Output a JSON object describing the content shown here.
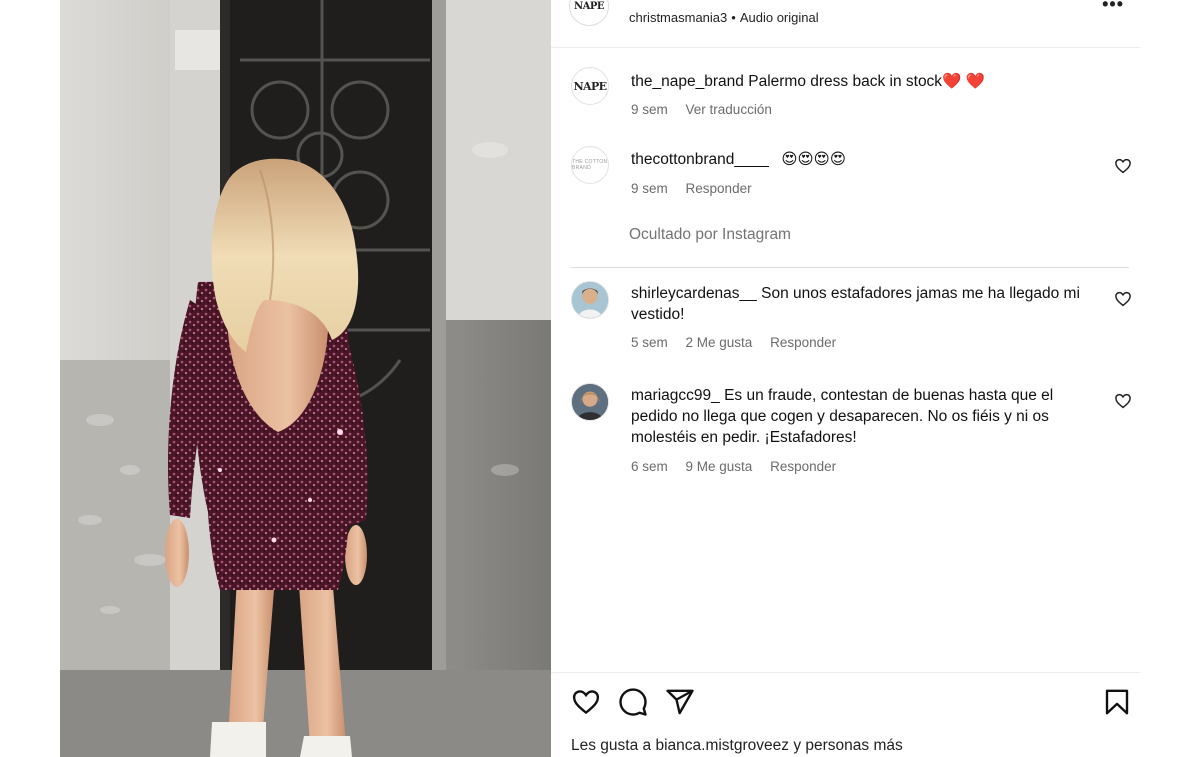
{
  "header": {
    "audio_user": "christmasmania3",
    "separator": "•",
    "audio_label": "Audio original",
    "brand_logo_text": "NAPE",
    "more_icon": "more-horizontal-icon"
  },
  "comments": [
    {
      "username": "the_nape_brand",
      "text": "Palermo dress back in stock",
      "emoji": "❤️ ❤️",
      "time": "9 sem",
      "action": "Ver traducción",
      "avatar_text": "NAPE"
    },
    {
      "username": "thecottonbrand____",
      "text": "",
      "emoji": "😍😍😍😍",
      "time": "9 sem",
      "action": "Responder",
      "avatar_text": "THE COTTON BRAND"
    },
    {
      "username": "shirleycardenas__",
      "text": "Son unos estafadores jamas me ha llegado mi vestido!",
      "time": "5 sem",
      "likes": "2 Me gusta",
      "action": "Responder"
    },
    {
      "username": "mariagcc99_",
      "text": "Es un fraude, contestan de buenas hasta que el pedido no llega que cogen y desaparecen. No os fiéis y ni os molestéis en pedir. ¡Estafadores!",
      "time": "6 sem",
      "likes": "9 Me gusta",
      "action": "Responder"
    }
  ],
  "hidden_note": "Ocultado por Instagram",
  "footer": {
    "likes_prefix": "Les gusta a",
    "likes_user": "bianca.mistgroveez",
    "likes_suffix": "y personas más",
    "icons": [
      "heart-icon",
      "comment-icon",
      "share-icon",
      "bookmark-icon"
    ]
  },
  "colors": {
    "meta_gray": "#6b6b6b",
    "heart_red": "#e0232f",
    "dress": "#4a1626"
  }
}
